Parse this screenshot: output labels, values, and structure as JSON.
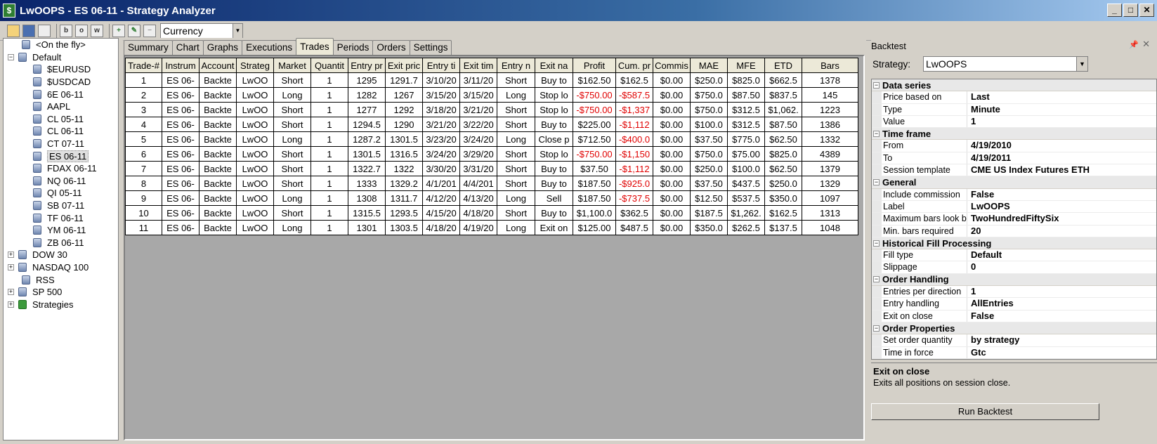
{
  "window": {
    "title": "LwOOPS - ES 06-11 - Strategy Analyzer",
    "buttons": [
      "_",
      "□",
      "✕"
    ]
  },
  "toolbar": {
    "icons": [
      "open-folder-icon",
      "save-icon",
      "flag-icon",
      "b-icon",
      "o-icon",
      "w-icon",
      "add-icon",
      "edit-icon",
      "remove-icon"
    ],
    "b_label": "b",
    "o_label": "o",
    "w_label": "w",
    "display_unit": "Currency"
  },
  "tree": [
    {
      "label": "<On the fly>",
      "level": 1,
      "expander": "",
      "icon": "db"
    },
    {
      "label": "Default",
      "level": 0,
      "expander": "−",
      "icon": "db"
    },
    {
      "label": "$EURUSD",
      "level": 2,
      "expander": "",
      "icon": "db"
    },
    {
      "label": "$USDCAD",
      "level": 2,
      "expander": "",
      "icon": "db"
    },
    {
      "label": "6E 06-11",
      "level": 2,
      "expander": "",
      "icon": "db"
    },
    {
      "label": "AAPL",
      "level": 2,
      "expander": "",
      "icon": "db"
    },
    {
      "label": "CL 05-11",
      "level": 2,
      "expander": "",
      "icon": "db"
    },
    {
      "label": "CL 06-11",
      "level": 2,
      "expander": "",
      "icon": "db"
    },
    {
      "label": "CT 07-11",
      "level": 2,
      "expander": "",
      "icon": "db"
    },
    {
      "label": "ES 06-11",
      "level": 2,
      "expander": "",
      "icon": "db",
      "selected": true
    },
    {
      "label": "FDAX 06-11",
      "level": 2,
      "expander": "",
      "icon": "db"
    },
    {
      "label": "NQ 06-11",
      "level": 2,
      "expander": "",
      "icon": "db"
    },
    {
      "label": "QI 05-11",
      "level": 2,
      "expander": "",
      "icon": "db"
    },
    {
      "label": "SB 07-11",
      "level": 2,
      "expander": "",
      "icon": "db"
    },
    {
      "label": "TF 06-11",
      "level": 2,
      "expander": "",
      "icon": "db"
    },
    {
      "label": "YM 06-11",
      "level": 2,
      "expander": "",
      "icon": "db"
    },
    {
      "label": "ZB 06-11",
      "level": 2,
      "expander": "",
      "icon": "db"
    },
    {
      "label": "DOW 30",
      "level": 0,
      "expander": "+",
      "icon": "db"
    },
    {
      "label": "NASDAQ 100",
      "level": 0,
      "expander": "+",
      "icon": "db"
    },
    {
      "label": "RSS",
      "level": 1,
      "expander": "",
      "icon": "db"
    },
    {
      "label": "SP 500",
      "level": 0,
      "expander": "+",
      "icon": "db"
    },
    {
      "label": "Strategies",
      "level": 0,
      "expander": "+",
      "icon": "strat"
    }
  ],
  "tabs": [
    "Summary",
    "Chart",
    "Graphs",
    "Executions",
    "Trades",
    "Periods",
    "Orders",
    "Settings"
  ],
  "active_tab": "Trades",
  "trades": {
    "columns": [
      "Trade-#",
      "Instrum",
      "Account",
      "Strateg",
      "Market",
      "Quantit",
      "Entry pr",
      "Exit pric",
      "Entry ti",
      "Exit tim",
      "Entry n",
      "Exit na",
      "Profit",
      "Cum. pr",
      "Commis",
      "MAE",
      "MFE",
      "ETD",
      "Bars"
    ],
    "rows": [
      [
        "1",
        "ES 06-",
        "Backte",
        "LwOO",
        "Short",
        "1",
        "1295",
        "1291.7",
        "3/10/20",
        "3/11/20",
        "Short",
        "Buy to",
        "$162.50",
        "$162.5",
        "$0.00",
        "$250.0",
        "$825.0",
        "$662.5",
        "1378"
      ],
      [
        "2",
        "ES 06-",
        "Backte",
        "LwOO",
        "Long",
        "1",
        "1282",
        "1267",
        "3/15/20",
        "3/15/20",
        "Long",
        "Stop lo",
        "-$750.00",
        "-$587.5",
        "$0.00",
        "$750.0",
        "$87.50",
        "$837.5",
        "145"
      ],
      [
        "3",
        "ES 06-",
        "Backte",
        "LwOO",
        "Short",
        "1",
        "1277",
        "1292",
        "3/18/20",
        "3/21/20",
        "Short",
        "Stop lo",
        "-$750.00",
        "-$1,337",
        "$0.00",
        "$750.0",
        "$312.5",
        "$1,062.",
        "1223"
      ],
      [
        "4",
        "ES 06-",
        "Backte",
        "LwOO",
        "Short",
        "1",
        "1294.5",
        "1290",
        "3/21/20",
        "3/22/20",
        "Short",
        "Buy to",
        "$225.00",
        "-$1,112",
        "$0.00",
        "$100.0",
        "$312.5",
        "$87.50",
        "1386"
      ],
      [
        "5",
        "ES 06-",
        "Backte",
        "LwOO",
        "Long",
        "1",
        "1287.2",
        "1301.5",
        "3/23/20",
        "3/24/20",
        "Long",
        "Close p",
        "$712.50",
        "-$400.0",
        "$0.00",
        "$37.50",
        "$775.0",
        "$62.50",
        "1332"
      ],
      [
        "6",
        "ES 06-",
        "Backte",
        "LwOO",
        "Short",
        "1",
        "1301.5",
        "1316.5",
        "3/24/20",
        "3/29/20",
        "Short",
        "Stop lo",
        "-$750.00",
        "-$1,150",
        "$0.00",
        "$750.0",
        "$75.00",
        "$825.0",
        "4389"
      ],
      [
        "7",
        "ES 06-",
        "Backte",
        "LwOO",
        "Short",
        "1",
        "1322.7",
        "1322",
        "3/30/20",
        "3/31/20",
        "Short",
        "Buy to",
        "$37.50",
        "-$1,112",
        "$0.00",
        "$250.0",
        "$100.0",
        "$62.50",
        "1379"
      ],
      [
        "8",
        "ES 06-",
        "Backte",
        "LwOO",
        "Short",
        "1",
        "1333",
        "1329.2",
        "4/1/201",
        "4/4/201",
        "Short",
        "Buy to",
        "$187.50",
        "-$925.0",
        "$0.00",
        "$37.50",
        "$437.5",
        "$250.0",
        "1329"
      ],
      [
        "9",
        "ES 06-",
        "Backte",
        "LwOO",
        "Long",
        "1",
        "1308",
        "1311.7",
        "4/12/20",
        "4/13/20",
        "Long",
        "Sell",
        "$187.50",
        "-$737.5",
        "$0.00",
        "$12.50",
        "$537.5",
        "$350.0",
        "1097"
      ],
      [
        "10",
        "ES 06-",
        "Backte",
        "LwOO",
        "Short",
        "1",
        "1315.5",
        "1293.5",
        "4/15/20",
        "4/18/20",
        "Short",
        "Buy to",
        "$1,100.0",
        "$362.5",
        "$0.00",
        "$187.5",
        "$1,262.",
        "$162.5",
        "1313"
      ],
      [
        "11",
        "ES 06-",
        "Backte",
        "LwOO",
        "Long",
        "1",
        "1301",
        "1303.5",
        "4/18/20",
        "4/19/20",
        "Long",
        "Exit on",
        "$125.00",
        "$487.5",
        "$0.00",
        "$350.0",
        "$262.5",
        "$137.5",
        "1048"
      ]
    ]
  },
  "backtest": {
    "title": "Backtest",
    "pin": "📌",
    "close": "✕",
    "strategy_label": "Strategy:",
    "strategy_value": "LwOOPS",
    "categories": [
      {
        "name": "Data series",
        "props": [
          [
            "Price based on",
            "Last"
          ],
          [
            "Type",
            "Minute"
          ],
          [
            "Value",
            "1"
          ]
        ]
      },
      {
        "name": "Time frame",
        "props": [
          [
            "From",
            "4/19/2010"
          ],
          [
            "To",
            "4/19/2011"
          ],
          [
            "Session template",
            "CME US Index Futures ETH"
          ]
        ]
      },
      {
        "name": "General",
        "props": [
          [
            "Include commission",
            "False"
          ],
          [
            "Label",
            "LwOOPS"
          ],
          [
            "Maximum bars look back",
            "TwoHundredFiftySix"
          ],
          [
            "Min. bars required",
            "20"
          ]
        ]
      },
      {
        "name": "Historical Fill Processing",
        "props": [
          [
            "Fill type",
            "Default"
          ],
          [
            "Slippage",
            "0"
          ]
        ]
      },
      {
        "name": "Order Handling",
        "props": [
          [
            "Entries per direction",
            "1"
          ],
          [
            "Entry handling",
            "AllEntries"
          ],
          [
            "Exit on close",
            "False"
          ]
        ]
      },
      {
        "name": "Order Properties",
        "props": [
          [
            "Set order quantity",
            "by strategy"
          ],
          [
            "Time in force",
            "Gtc"
          ]
        ]
      }
    ],
    "help_title": "Exit on close",
    "help_text": "Exits all positions on session close.",
    "run_label": "Run Backtest"
  }
}
